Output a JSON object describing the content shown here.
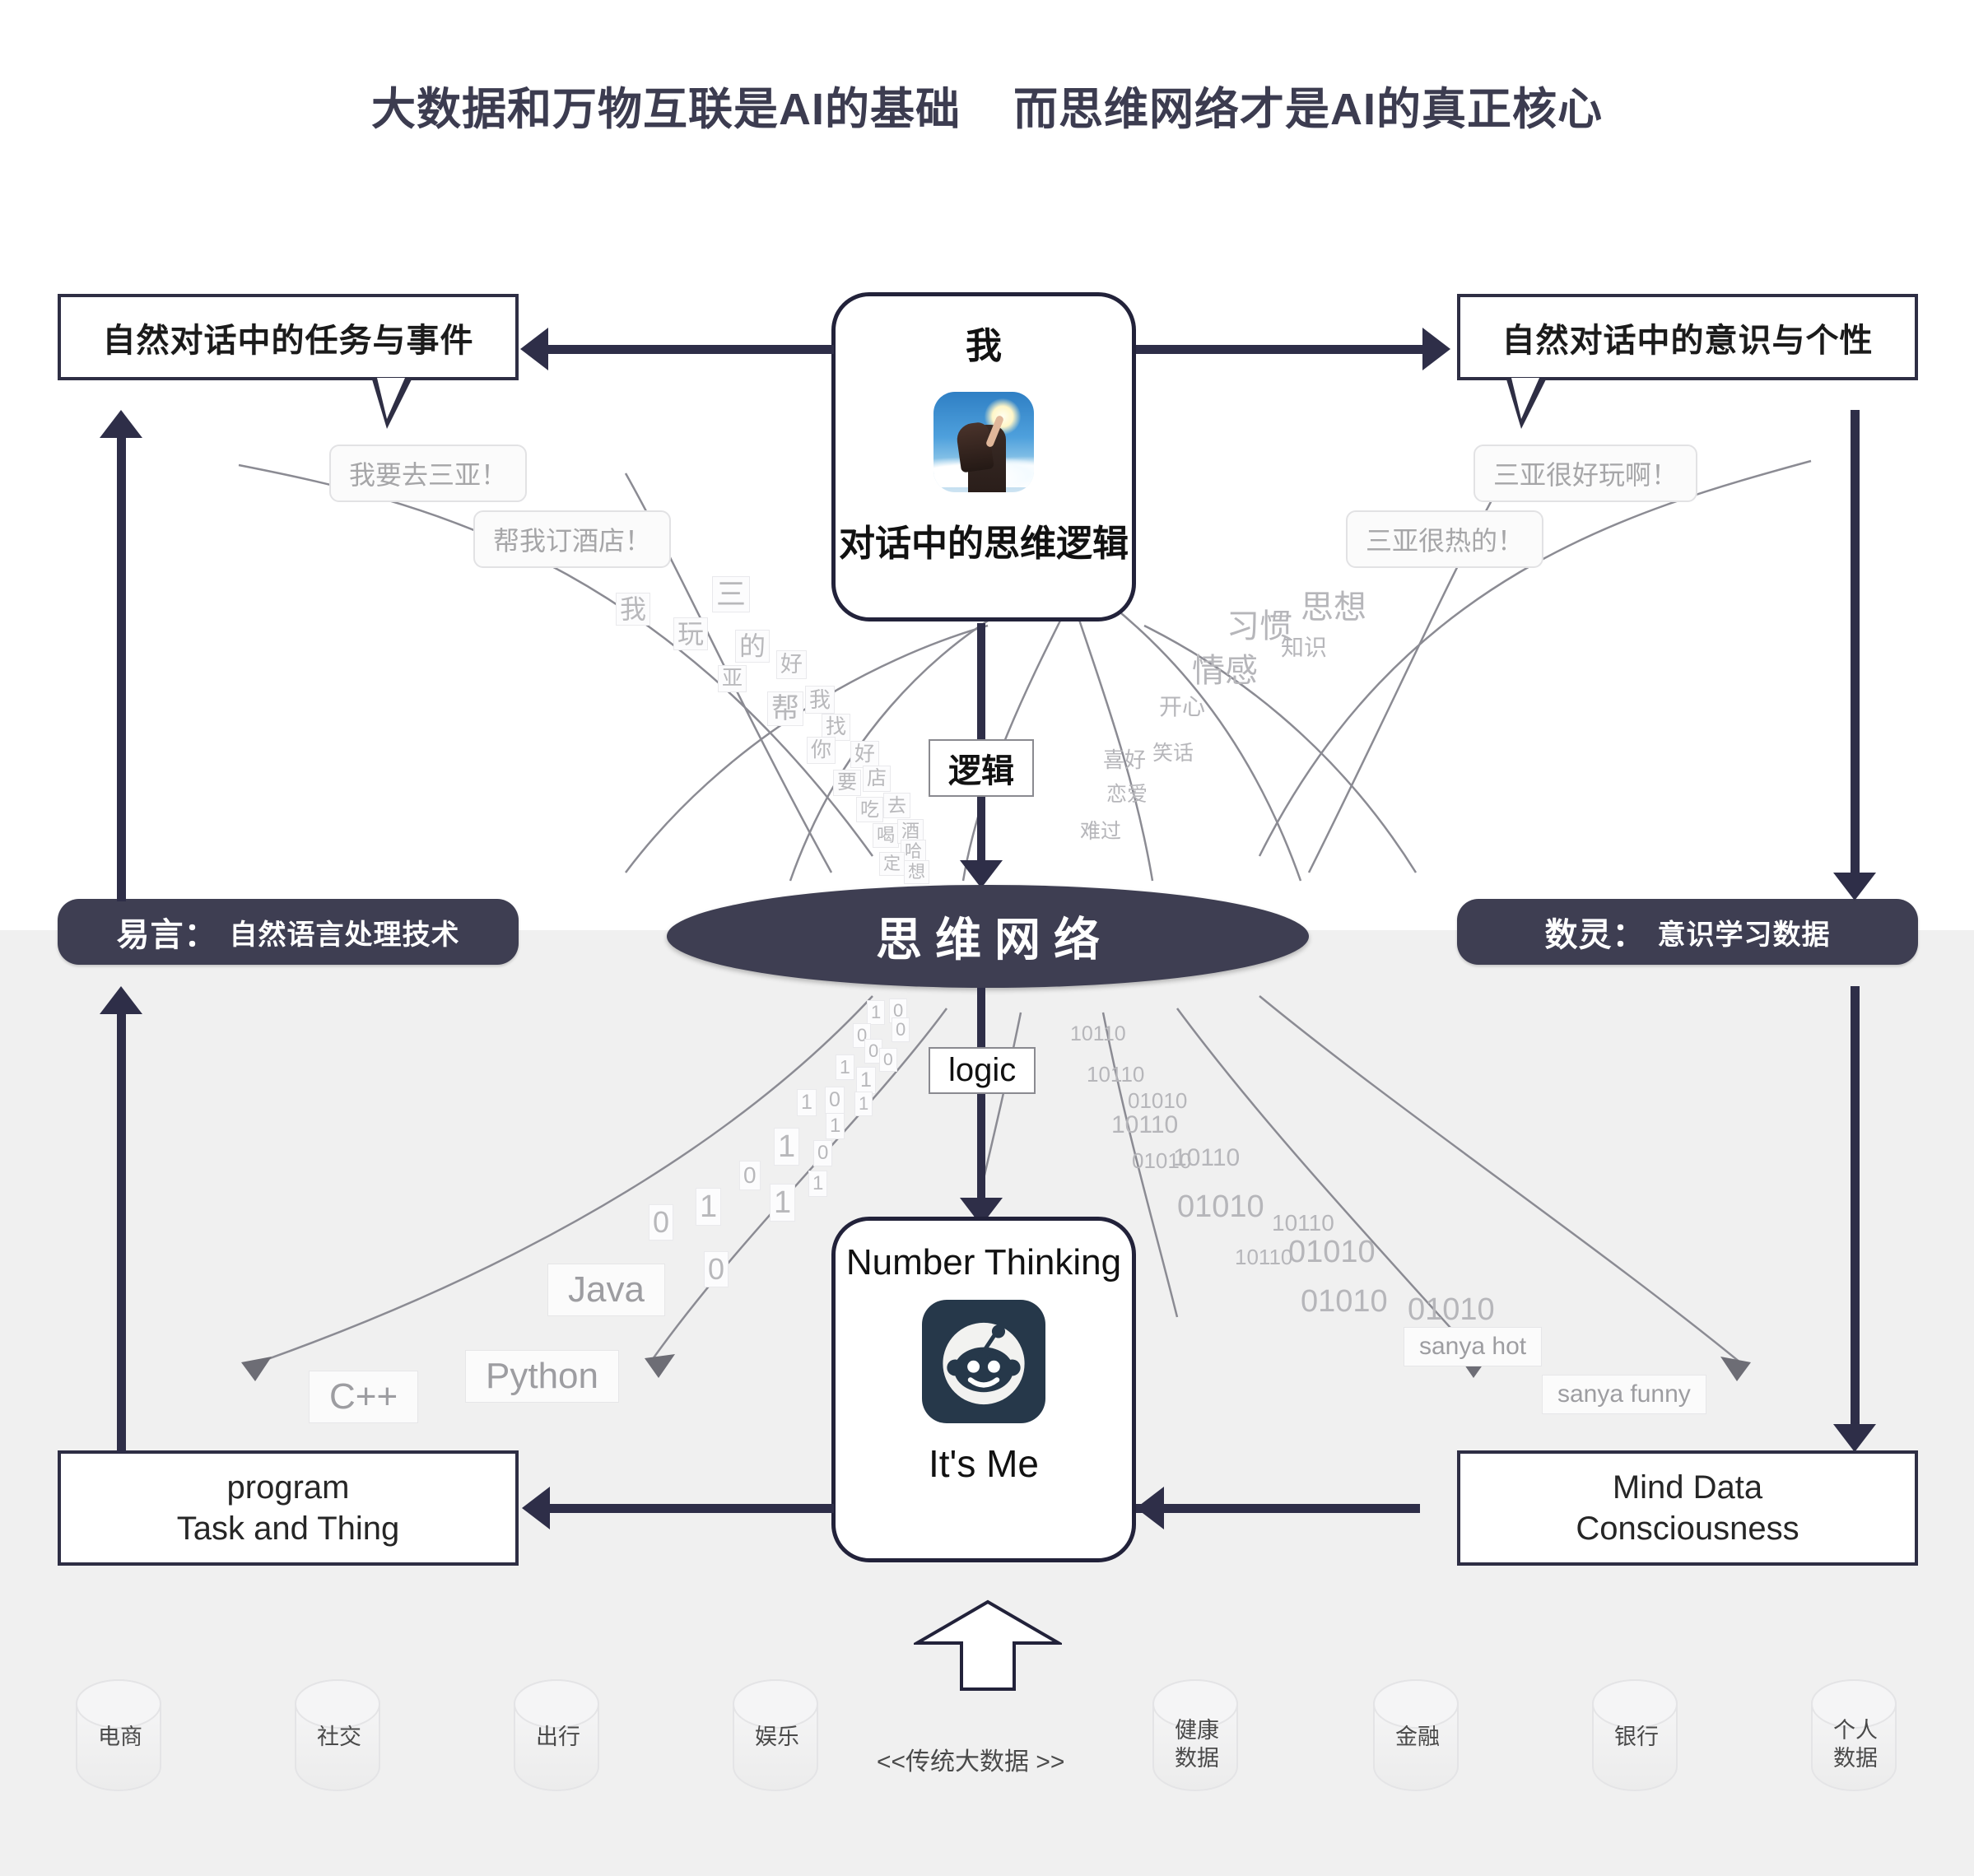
{
  "title": "大数据和万物互联是AI的基础    而思维网络才是AI的真正核心",
  "boxes": {
    "top_left": "自然对话中的任务与事件",
    "top_right": "自然对话中的意识与个性",
    "center_top_title": "我",
    "center_top_caption": "对话中的思维逻辑",
    "left_pill_strong": "易言：",
    "left_pill_light": "自然语言处理技术",
    "right_pill_strong": "数灵：",
    "right_pill_light": "意识学习数据",
    "center_ellipse": "思维网络",
    "center_bottom_title": "Number Thinking",
    "center_bottom_caption": "It's Me",
    "bottom_left_line1": "program",
    "bottom_left_line2": "Task and Thing",
    "bottom_right_line1": "Mind Data",
    "bottom_right_line2": "Consciousness"
  },
  "chips": {
    "logic_cn": "逻辑",
    "logic_en": "logic"
  },
  "bubbles": {
    "left": [
      "我要去三亚！",
      "帮我订酒店！"
    ],
    "right": [
      "三亚很好玩啊！",
      "三亚很热的！"
    ]
  },
  "left_glyphs": [
    "我",
    "三",
    "玩",
    "的",
    "好",
    "亚",
    "帮",
    "我",
    "找",
    "你",
    "好",
    "要",
    "店",
    "吃",
    "去",
    "喝",
    "酒",
    "哈",
    "定",
    "想"
  ],
  "right_words": [
    "思想",
    "习惯",
    "知识",
    "情感",
    "开心",
    "笑话",
    "喜好",
    "恋爱",
    "难过"
  ],
  "binary_digits": [
    "1",
    "0",
    "0",
    "0",
    "0",
    "0",
    "1",
    "1",
    "1",
    "0",
    "1",
    "1",
    "1",
    "0",
    "1",
    "0",
    "1",
    "1",
    "0"
  ],
  "binary_words": [
    "10110",
    "10110",
    "01010",
    "10110",
    "01010",
    "10110",
    "01010",
    "10110",
    "10110",
    "01010",
    "01010",
    "01010"
  ],
  "languages": [
    "Java",
    "Python",
    "C++"
  ],
  "english_tags": [
    "sanya hot",
    "sanya funny"
  ],
  "bigdata_label": "<<传统大数据 >>",
  "cylinders": [
    {
      "label": "电商"
    },
    {
      "label": "社交"
    },
    {
      "label": "出行"
    },
    {
      "label": "娱乐"
    },
    {
      "label": "健康\n数据"
    },
    {
      "label": "金融"
    },
    {
      "label": "银行"
    },
    {
      "label": "个人\n数据"
    }
  ],
  "colors": {
    "ink": "#2e2e48",
    "pill": "#3e3e52",
    "band": "#f0f0f0",
    "muted": "#b6b6ba"
  }
}
